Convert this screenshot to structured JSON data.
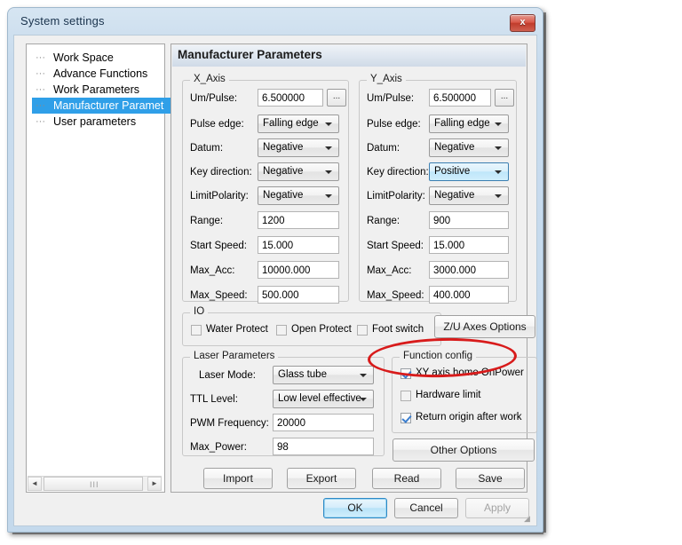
{
  "window": {
    "title": "System settings",
    "close_label": "x"
  },
  "tree": {
    "items": [
      {
        "label": "Work Space",
        "selected": false
      },
      {
        "label": "Advance Functions",
        "selected": false
      },
      {
        "label": "Work Parameters",
        "selected": false
      },
      {
        "label": "Manufacturer Paramet",
        "selected": true
      },
      {
        "label": "User parameters",
        "selected": false
      }
    ],
    "scrollbar": {
      "left_arrow": "◄",
      "right_arrow": "►",
      "grip": "III"
    }
  },
  "page": {
    "header": "Manufacturer Parameters"
  },
  "x_axis": {
    "group_title": "X_Axis",
    "fields": {
      "um_pulse": {
        "label": "Um/Pulse:",
        "value": "6.500000",
        "browse": "..."
      },
      "pulse_edge": {
        "label": "Pulse edge:",
        "value": "Falling edge"
      },
      "datum": {
        "label": "Datum:",
        "value": "Negative"
      },
      "key_direction": {
        "label": "Key direction:",
        "value": "Negative"
      },
      "limit_polarity": {
        "label": "LimitPolarity:",
        "value": "Negative"
      },
      "range": {
        "label": "Range:",
        "value": "1200"
      },
      "start_speed": {
        "label": "Start Speed:",
        "value": "15.000"
      },
      "max_acc": {
        "label": "Max_Acc:",
        "value": "10000.000"
      },
      "max_speed": {
        "label": "Max_Speed:",
        "value": "500.000"
      }
    }
  },
  "y_axis": {
    "group_title": "Y_Axis",
    "fields": {
      "um_pulse": {
        "label": "Um/Pulse:",
        "value": "6.500000",
        "browse": "..."
      },
      "pulse_edge": {
        "label": "Pulse edge:",
        "value": "Falling edge"
      },
      "datum": {
        "label": "Datum:",
        "value": "Negative"
      },
      "key_direction": {
        "label": "Key direction:",
        "value": "Positive"
      },
      "limit_polarity": {
        "label": "LimitPolarity:",
        "value": "Negative"
      },
      "range": {
        "label": "Range:",
        "value": "900"
      },
      "start_speed": {
        "label": "Start Speed:",
        "value": "15.000"
      },
      "max_acc": {
        "label": "Max_Acc:",
        "value": "3000.000"
      },
      "max_speed": {
        "label": "Max_Speed:",
        "value": "400.000"
      }
    }
  },
  "io": {
    "group_title": "IO",
    "checkboxes": [
      {
        "label": "Water Protect",
        "checked": false
      },
      {
        "label": "Open Protect",
        "checked": false
      },
      {
        "label": "Foot switch",
        "checked": false
      }
    ],
    "zu_button": "Z/U Axes Options"
  },
  "laser": {
    "group_title": "Laser Parameters",
    "laser_mode": {
      "label": "Laser Mode:",
      "value": "Glass tube"
    },
    "ttl_level": {
      "label": "TTL Level:",
      "value": "Low level effective"
    },
    "pwm_frequency": {
      "label": "PWM Frequency:",
      "value": "20000"
    },
    "max_power": {
      "label": "Max_Power:",
      "value": "98"
    }
  },
  "function_config": {
    "group_title": "Function config",
    "checkboxes": [
      {
        "label": "XY axis home OnPower",
        "checked": true
      },
      {
        "label": "Hardware limit",
        "checked": false
      },
      {
        "label": "Return origin after work",
        "checked": true
      }
    ],
    "other_options_button": "Other Options"
  },
  "action_buttons": {
    "import": "Import",
    "export": "Export",
    "read": "Read",
    "save": "Save"
  },
  "dialog_buttons": {
    "ok": "OK",
    "cancel": "Cancel",
    "apply": "Apply"
  },
  "annotation": {
    "shape": "red-ellipse",
    "target": "XY axis home OnPower",
    "color": "#d81b1b"
  }
}
